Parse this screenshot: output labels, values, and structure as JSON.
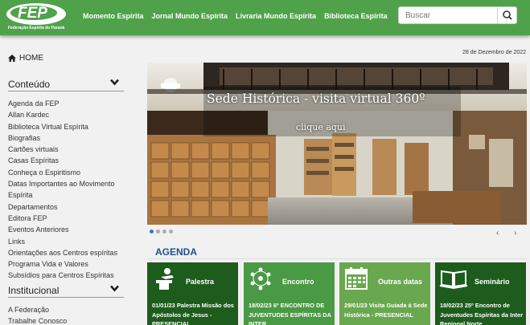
{
  "header": {
    "logo_text": "FEP",
    "logo_subtitle": "Federação Espírita do Paraná",
    "nav": [
      "Momento Espírita",
      "Jornal Mundo Espírita",
      "Livraria Mundo Espírita",
      "Biblioteca Espírita"
    ],
    "search_placeholder": "Buscar"
  },
  "sidebar": {
    "home_label": "HOME",
    "sections": [
      {
        "title": "Conteúdo",
        "items": [
          "Agenda da FEP",
          "Allan Kardec",
          "Biblioteca Virtual Espírita",
          "Biografias",
          "Cartões virtuais",
          "Casas Espíritas",
          "Conheça o Espiritismo",
          "Datas Importantes ao Movimento Espírita",
          "Departamentos",
          "Editora FEP",
          "Eventos Anteriores",
          "Links",
          "Orientações aos Centros espíritas",
          "Programa Vida e Valores",
          "Subsídios para Centros Espíritas"
        ]
      },
      {
        "title": "Institucional",
        "items": [
          "A Federação",
          "Trabalhe Conosco"
        ]
      }
    ]
  },
  "main": {
    "date": "28 de Dezembro de 2022",
    "hero": {
      "title": "Sede Histórica - visita virtual 360º",
      "cta": "clique aqui"
    },
    "carousel_dots": 4,
    "carousel_active": 0,
    "agenda_title": "AGENDA",
    "cards": [
      {
        "kind": "Palestra",
        "icon": "speaker-icon",
        "color": "#1d5c1d",
        "desc": "01/01/23 Palestra Missão dos Apóstolos de Jesus - PRESENCIAL"
      },
      {
        "kind": "Encontro",
        "icon": "group-icon",
        "color": "#4a9a45",
        "desc": "18/02/23 6º ENCONTRO DE JUVENTUDES ESPÍRITAS DA INTER"
      },
      {
        "kind": "Outras datas",
        "icon": "calendar-icon",
        "color": "#6aa84f",
        "desc": "29/01/23 Visita Guiada à Sede Histórica - PRESENCIAL"
      },
      {
        "kind": "Seminário",
        "icon": "book-icon",
        "color": "#1d5c1d",
        "desc": "18/02/23 25º Encontro de Juventudes Espíritas da Inter Regional Norte"
      }
    ]
  }
}
